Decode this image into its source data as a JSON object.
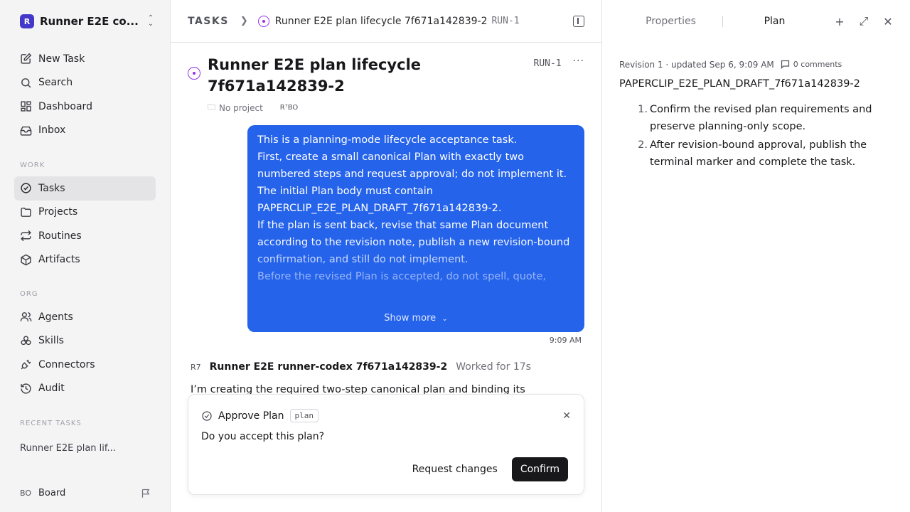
{
  "workspace": {
    "logo": "R",
    "name": "Runner E2E co..."
  },
  "nav": [
    {
      "label": "New Task",
      "icon": "edit-icon"
    },
    {
      "label": "Search",
      "icon": "search-icon"
    },
    {
      "label": "Dashboard",
      "icon": "dashboard-icon"
    },
    {
      "label": "Inbox",
      "icon": "inbox-icon"
    }
  ],
  "work_section": {
    "label": "WORK",
    "items": [
      {
        "label": "Tasks",
        "icon": "check-circle-icon",
        "active": true
      },
      {
        "label": "Projects",
        "icon": "folder-icon"
      },
      {
        "label": "Routines",
        "icon": "repeat-icon"
      },
      {
        "label": "Artifacts",
        "icon": "box-icon"
      }
    ]
  },
  "org_section": {
    "label": "ORG",
    "items": [
      {
        "label": "Agents",
        "icon": "users-icon"
      },
      {
        "label": "Skills",
        "icon": "skills-icon"
      },
      {
        "label": "Connectors",
        "icon": "plug-icon"
      },
      {
        "label": "Audit",
        "icon": "history-icon"
      }
    ]
  },
  "recent": {
    "label": "RECENT TASKS",
    "items": [
      "Runner E2E plan lif..."
    ]
  },
  "user": {
    "badge": "BO",
    "name": "Board"
  },
  "breadcrumb": {
    "root": "TASKS",
    "title": "Runner E2E plan lifecycle 7f671a142839-2",
    "id": "RUN-1"
  },
  "task": {
    "title": "Runner E2E plan lifecycle 7f671a142839-2",
    "id": "RUN-1",
    "project": "No project",
    "avatars": "R⁷BO"
  },
  "message": {
    "lines": [
      "This is a planning-mode lifecycle acceptance task.",
      "First, create a small canonical Plan with exactly two numbered steps and request approval; do not implement it.",
      "The initial Plan body must contain PAPERCLIP_E2E_PLAN_DRAFT_7f671a142839-2.",
      "If the plan is sent back, revise that same Plan document according to the revision note, publish a new revision-bound confirmation, and still do not implement.",
      "Before the revised Plan is accepted, do not spell, quote,"
    ],
    "show_more": "Show more",
    "time": "9:09 AM"
  },
  "agent": {
    "badge": "R7",
    "name": "Runner E2E runner-codex 7f671a142839-2",
    "worked": "Worked for 17s",
    "message": "I’m creating the required two-step canonical plan and binding its"
  },
  "approval": {
    "title": "Approve Plan",
    "tag": "plan",
    "question": "Do you accept this plan?",
    "request_changes": "Request changes",
    "confirm": "Confirm"
  },
  "right_panel": {
    "tabs": [
      "Properties",
      "Plan"
    ],
    "active_tab": "Plan",
    "revision": "Revision 1 · updated Sep 6, 9:09 AM",
    "comments": "0 comments",
    "doc_title": "PAPERCLIP_E2E_PLAN_DRAFT_7f671a142839-2",
    "steps": [
      "Confirm the revised plan requirements and preserve planning-only scope.",
      "After revision-bound approval, publish the terminal marker and complete the task."
    ]
  }
}
